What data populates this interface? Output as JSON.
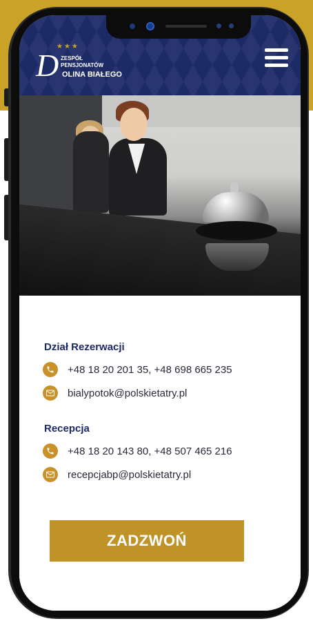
{
  "colors": {
    "brand_navy": "#1c2a66",
    "brand_gold": "#c09329",
    "icon_gold": "#c9912a"
  },
  "header": {
    "logo": {
      "stars": "★★★",
      "letter": "D",
      "line1": "ZESPÓŁ",
      "line2": "PENSJONATÓW",
      "line3": "OLINA BIAŁEGO"
    },
    "menu_icon": "hamburger-menu-icon"
  },
  "hero": {
    "image_subject": "reception-desk-with-service-bell"
  },
  "contact": {
    "reservations": {
      "title": "Dział Rezerwacji",
      "phone": "+48 18 20 201 35, +48 698 665 235",
      "email": "bialypotok@polskietatry.pl"
    },
    "reception": {
      "title": "Recepcja",
      "phone": "+48 18 20 143 80, +48 507 465 216",
      "email": "recepcjabp@polskietatry.pl"
    }
  },
  "cta": {
    "call_label": "ZADZWOŃ"
  }
}
